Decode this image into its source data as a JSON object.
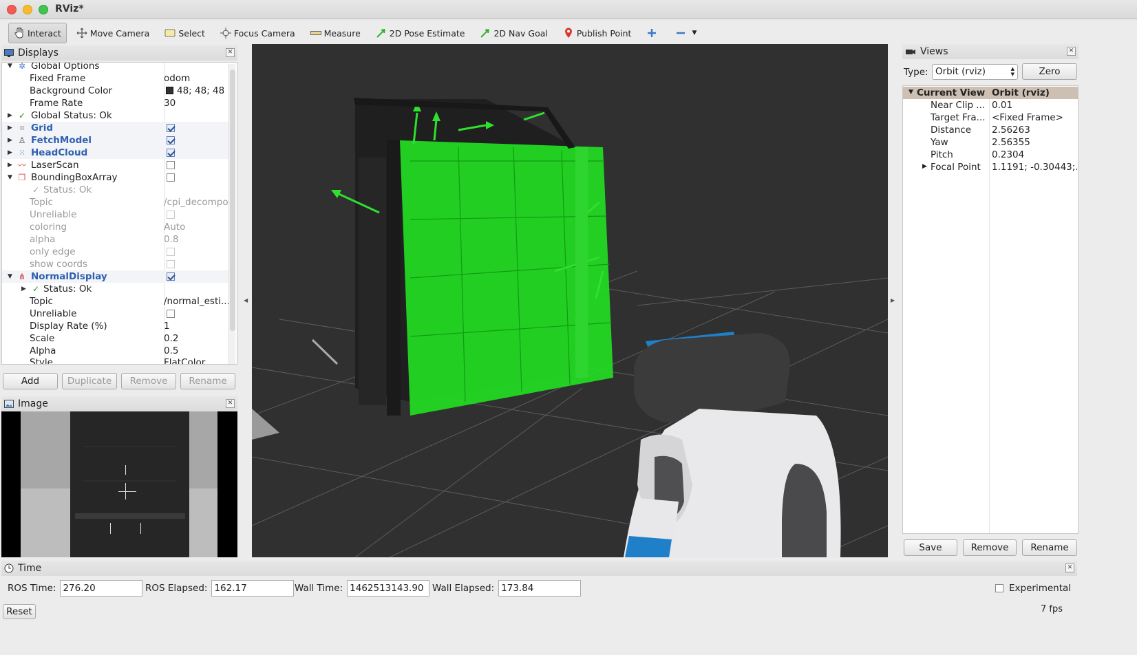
{
  "window": {
    "title": "RViz*"
  },
  "toolbar": {
    "tools": [
      "Interact",
      "Move Camera",
      "Select",
      "Focus Camera",
      "Measure",
      "2D Pose Estimate",
      "2D Nav Goal",
      "Publish Point"
    ]
  },
  "displays": {
    "title": "Displays",
    "rows": {
      "global_options": "Global Options",
      "fixed_frame": {
        "label": "Fixed Frame",
        "value": "odom"
      },
      "background_color": {
        "label": "Background Color",
        "value": "48; 48; 48"
      },
      "frame_rate": {
        "label": "Frame Rate",
        "value": "30"
      },
      "global_status": "Global Status: Ok",
      "grid": "Grid",
      "fetch_model": "FetchModel",
      "head_cloud": "HeadCloud",
      "laser_scan": "LaserScan",
      "bbox_array": "BoundingBoxArray",
      "bbox_status": "Status: Ok",
      "bbox_topic": {
        "label": "Topic",
        "value": "/cpi_decompo..."
      },
      "bbox_unreliable": "Unreliable",
      "bbox_coloring": {
        "label": "coloring",
        "value": "Auto"
      },
      "bbox_alpha": {
        "label": "alpha",
        "value": "0.8"
      },
      "bbox_only_edge": "only edge",
      "bbox_show_coords": "show coords",
      "normal_display": "NormalDisplay",
      "nd_status": "Status: Ok",
      "nd_topic": {
        "label": "Topic",
        "value": "/normal_esti..."
      },
      "nd_unreliable": "Unreliable",
      "nd_display_rate": {
        "label": "Display Rate (%)",
        "value": "1"
      },
      "nd_scale": {
        "label": "Scale",
        "value": "0.2"
      },
      "nd_alpha": {
        "label": "Alpha",
        "value": "0.5"
      },
      "nd_style": {
        "label": "Style",
        "value": "FlatColor"
      }
    },
    "buttons": {
      "add": "Add",
      "duplicate": "Duplicate",
      "remove": "Remove",
      "rename": "Rename"
    }
  },
  "image_panel": {
    "title": "Image"
  },
  "views": {
    "title": "Views",
    "type_label": "Type:",
    "type_value": "Orbit (rviz)",
    "zero": "Zero",
    "header": {
      "name": "Current View",
      "value": "Orbit (rviz)"
    },
    "props": [
      {
        "label": "Near Clip ...",
        "value": "0.01"
      },
      {
        "label": "Target Fra...",
        "value": "<Fixed Frame>"
      },
      {
        "label": "Distance",
        "value": "2.56263"
      },
      {
        "label": "Yaw",
        "value": "2.56355"
      },
      {
        "label": "Pitch",
        "value": "0.2304"
      },
      {
        "label": "Focal Point",
        "value": "1.1191; -0.30443;..."
      }
    ],
    "buttons": {
      "save": "Save",
      "remove": "Remove",
      "rename": "Rename"
    }
  },
  "time": {
    "title": "Time",
    "ros_time_label": "ROS Time:",
    "ros_time": "276.20",
    "ros_elapsed_label": "ROS Elapsed:",
    "ros_elapsed": "162.17",
    "wall_time_label": "Wall Time:",
    "wall_time": "1462513143.90",
    "wall_elapsed_label": "Wall Elapsed:",
    "wall_elapsed": "173.84",
    "experimental": "Experimental",
    "reset": "Reset",
    "fps": "7 fps"
  },
  "colors": {
    "accent": "#2f5fb0",
    "viewport_bg": "#303030",
    "normals": "#22dd22",
    "robot_blue": "#1f7fc8"
  }
}
